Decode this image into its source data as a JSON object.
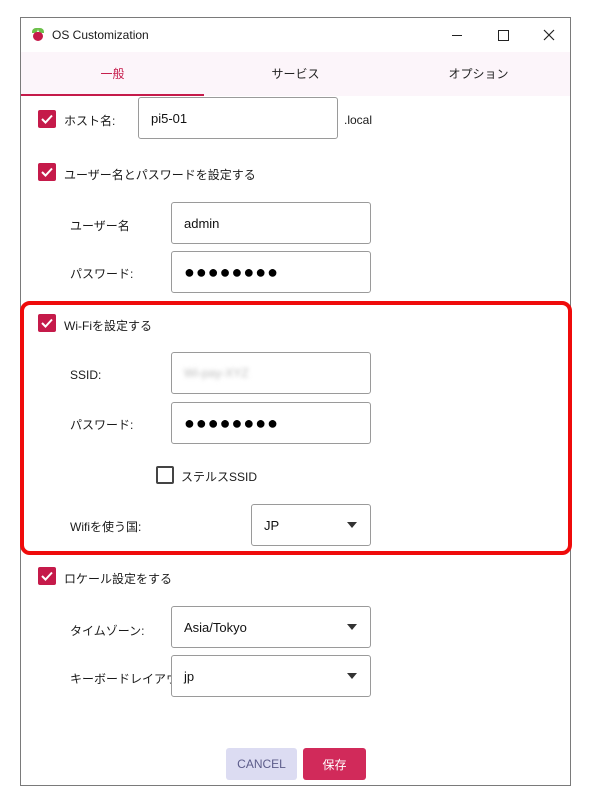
{
  "window": {
    "title": "OS Customization"
  },
  "tabs": [
    {
      "label": "一般",
      "active": true
    },
    {
      "label": "サービス",
      "active": false
    },
    {
      "label": "オプション",
      "active": false
    }
  ],
  "hostname": {
    "checked": true,
    "label": "ホスト名:",
    "value": "pi5-01",
    "suffix": ".local"
  },
  "user": {
    "checked": true,
    "label": "ユーザー名とパスワードを設定する",
    "username_label": "ユーザー名",
    "username_value": "admin",
    "password_label": "パスワード:",
    "password_value": "●●●●●●●●"
  },
  "wifi": {
    "checked": true,
    "label": "Wi-Fiを設定する",
    "ssid_label": "SSID:",
    "ssid_value": "Wi-pay-XYZ",
    "password_label": "パスワード:",
    "password_value": "●●●●●●●●",
    "hidden_ssid_checked": false,
    "hidden_ssid_label": "ステルスSSID",
    "country_label": "Wifiを使う国:",
    "country_value": "JP"
  },
  "locale": {
    "checked": true,
    "label": "ロケール設定をする",
    "timezone_label": "タイムゾーン:",
    "timezone_value": "Asia/Tokyo",
    "keyboard_label": "キーボードレイアウト:",
    "keyboard_value": "jp"
  },
  "buttons": {
    "cancel": "CANCEL",
    "save": "保存"
  },
  "colors": {
    "accent": "#c51a4a",
    "highlight": "#ef0b0b",
    "tab_bg": "#fcf5fa"
  }
}
